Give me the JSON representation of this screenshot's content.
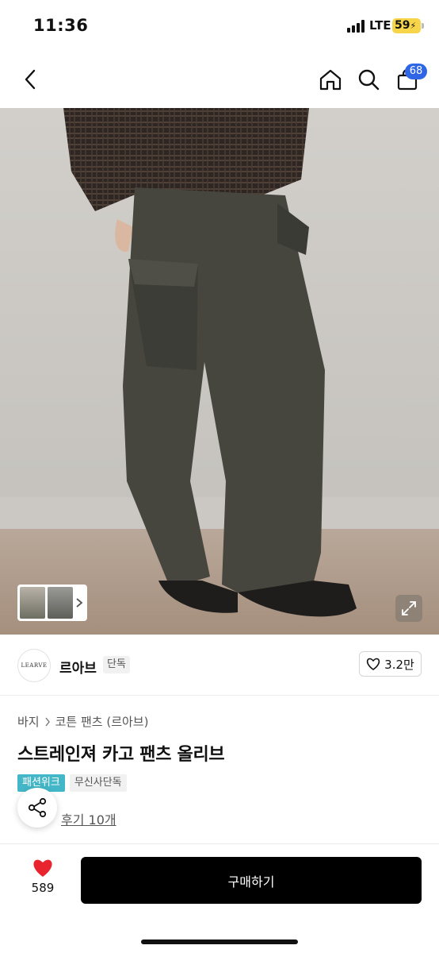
{
  "status_bar": {
    "time": "11:36",
    "network": "LTE",
    "battery": "59"
  },
  "nav": {
    "back_icon": "chevron-left-icon",
    "home_icon": "home-icon",
    "search_icon": "search-icon",
    "cart_icon": "shopping-bag-icon",
    "cart_count": "68"
  },
  "brand": {
    "logo_text": "LEARVE",
    "name": "르아브",
    "tag": "단독",
    "likes": "3.2만"
  },
  "product": {
    "breadcrumb": [
      "바지",
      "코튼 팬츠 (르아브)"
    ],
    "title": "스트레인져 카고 팬츠 올리브",
    "tags": [
      "패션위크",
      "무신사단독"
    ],
    "review_link": "후기 10개"
  },
  "bottom_bar": {
    "favorite_count": "589",
    "buy_label": "구매하기"
  },
  "colors": {
    "accent_badge": "#2f66e6",
    "tag_fashionweek": "#43b7c7",
    "heart": "#e8242e",
    "buy_button": "#000000"
  }
}
